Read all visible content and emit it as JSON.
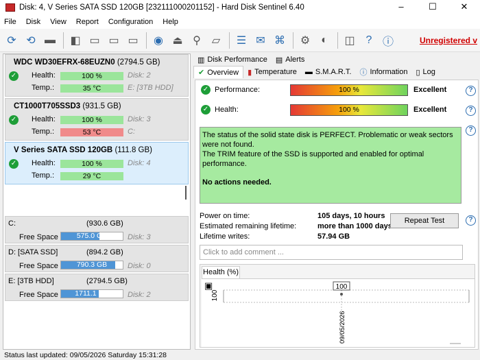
{
  "window": {
    "title": "Disk: 4, V Series SATA SSD 120GB [232111000201152]  -  Hard Disk Sentinel 6.40",
    "min": "–",
    "max": "☐",
    "close": "✕"
  },
  "menu": [
    "File",
    "Disk",
    "View",
    "Report",
    "Configuration",
    "Help"
  ],
  "toolbar": {
    "unregistered": "Unregistered v"
  },
  "disks": [
    {
      "name": "WDC WD30EFRX-68EUZN0",
      "size": "(2794.5 GB)",
      "health_label": "Health:",
      "health": "100 %",
      "disk": "Disk: 2",
      "temp_label": "Temp.:",
      "temp": "35 °C",
      "temp_status": "ok",
      "extra": "E: [3TB HDD]"
    },
    {
      "name": "CT1000T705SSD3",
      "size": "(931.5 GB)",
      "health_label": "Health:",
      "health": "100 %",
      "disk": "Disk: 3",
      "temp_label": "Temp.:",
      "temp": "53 °C",
      "temp_status": "hot",
      "extra": "C:"
    },
    {
      "name": "V Series SATA SSD 120GB",
      "size": "(111.8 GB)",
      "health_label": "Health:",
      "health": "100 %",
      "disk": "Disk: 4",
      "temp_label": "Temp.:",
      "temp": "29 °C",
      "temp_status": "ok",
      "extra": ""
    }
  ],
  "volumes": [
    {
      "name": "C:",
      "size": "(930.6 GB)",
      "free_label": "Free Space",
      "free": "575.0 GB",
      "free_fraction": 0.62,
      "disk": "Disk: 3"
    },
    {
      "name": "D: [SATA SSD]",
      "size": "(894.2 GB)",
      "free_label": "Free Space",
      "free": "790.3 GB",
      "free_fraction": 0.88,
      "disk": "Disk: 0"
    },
    {
      "name": "E: [3TB HDD]",
      "size": "(2794.5 GB)",
      "free_label": "Free Space",
      "free": "1711.1 GB",
      "free_fraction": 0.61,
      "disk": "Disk: 2"
    }
  ],
  "tabs_top": [
    "Disk Performance",
    "Alerts"
  ],
  "tabs": [
    "Overview",
    "Temperature",
    "S.M.A.R.T.",
    "Information",
    "Log"
  ],
  "overview": {
    "performance_label": "Performance:",
    "performance": "100 %",
    "performance_rating": "Excellent",
    "health_label": "Health:",
    "health": "100 %",
    "health_rating": "Excellent",
    "status_text": "The status of the solid state disk is PERFECT. Problematic or weak sectors were not found.",
    "trim_text": "The TRIM feature of the SSD is supported and enabled for optimal performance.",
    "actions": "No actions needed.",
    "power_on_label": "Power on time:",
    "power_on": "105 days, 10 hours",
    "lifetime_label": "Estimated remaining lifetime:",
    "lifetime": "more than 1000 days",
    "writes_label": "Lifetime writes:",
    "writes": "57.94 GB",
    "repeat_test": "Repeat Test",
    "comment_placeholder": "Click to add comment ..."
  },
  "health_chart": {
    "tab": "Health (%)",
    "ylabel": "100",
    "point_label": "100",
    "date": "09/05/2026"
  },
  "statusbar": "Status last updated: 09/05/2026 Saturday 15:31:28",
  "colors": {
    "ok": "#9be59b",
    "hot": "#f08a8a",
    "status_bg": "#a6eaa0",
    "accent": "#2b6cb0",
    "unregistered": "#d00000"
  }
}
